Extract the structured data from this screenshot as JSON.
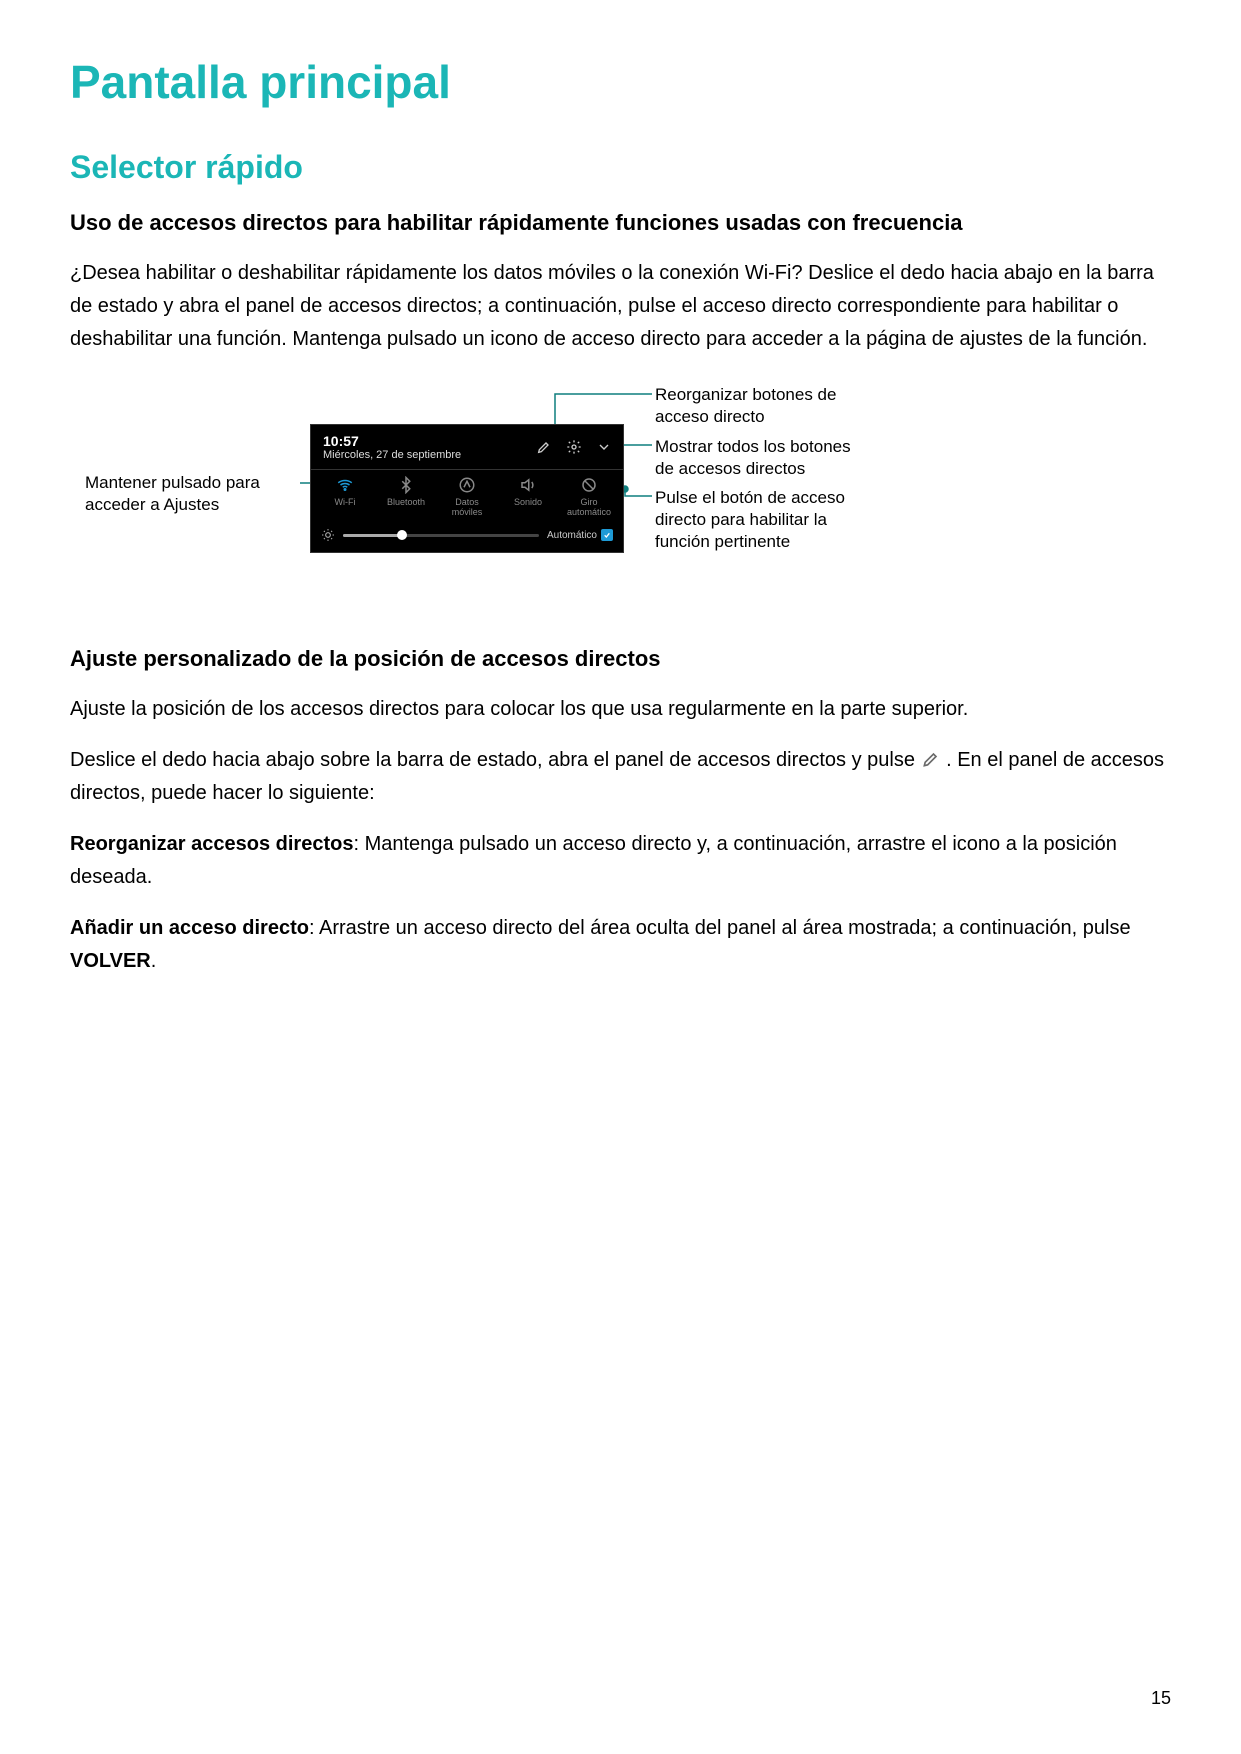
{
  "page_number": "15",
  "title": "Pantalla principal",
  "section": "Selector rápido",
  "sub1_title": "Uso de accesos directos para habilitar rápidamente funciones usadas con frecuencia",
  "sub1_body": "¿Desea habilitar o deshabilitar rápidamente los datos móviles o la conexión Wi-Fi? Deslice el dedo hacia abajo en la barra de estado y abra el panel de accesos directos; a continuación, pulse el acceso directo correspondiente para habilitar o deshabilitar una función. Mantenga pulsado un icono de acceso directo para acceder a la página de ajustes de la función.",
  "callouts": {
    "left": "Mantener pulsado para acceder a Ajustes",
    "c1": "Reorganizar botones de acceso directo",
    "c2": "Mostrar todos los botones de accesos directos",
    "c3": "Pulse el botón de acceso directo para habilitar la función pertinente"
  },
  "panel": {
    "time": "10:57",
    "date": "Miércoles, 27 de septiembre",
    "brightness_auto": "Automático",
    "toggles": [
      {
        "name": "wifi-icon",
        "label": "Wi-Fi",
        "active": true
      },
      {
        "name": "bluetooth-icon",
        "label": "Bluetooth",
        "active": false
      },
      {
        "name": "mobile-data-icon",
        "label": "Datos móviles",
        "active": false
      },
      {
        "name": "sound-icon",
        "label": "Sonido",
        "active": false
      },
      {
        "name": "autorotate-icon",
        "label": "Giro automático",
        "active": false
      }
    ]
  },
  "sub2_title": "Ajuste personalizado de la posición de accesos directos",
  "sub2_body1": "Ajuste la posición de los accesos directos para colocar los que usa regularmente en la parte superior.",
  "sub2_body2a": "Deslice el dedo hacia abajo sobre la barra de estado, abra el panel de accesos directos y pulse ",
  "sub2_body2b": " . En el panel de accesos directos, puede hacer lo siguiente:",
  "sub2_p3_strong": "Reorganizar accesos directos",
  "sub2_p3_rest": ": Mantenga pulsado un acceso directo y, a continuación, arrastre el icono a la posición deseada.",
  "sub2_p4_strong": "Añadir un acceso directo",
  "sub2_p4_mid": ": Arrastre un acceso directo del área oculta del panel al área mostrada; a continuación, pulse ",
  "sub2_p4_bold": "VOLVER",
  "sub2_p4_end": "."
}
